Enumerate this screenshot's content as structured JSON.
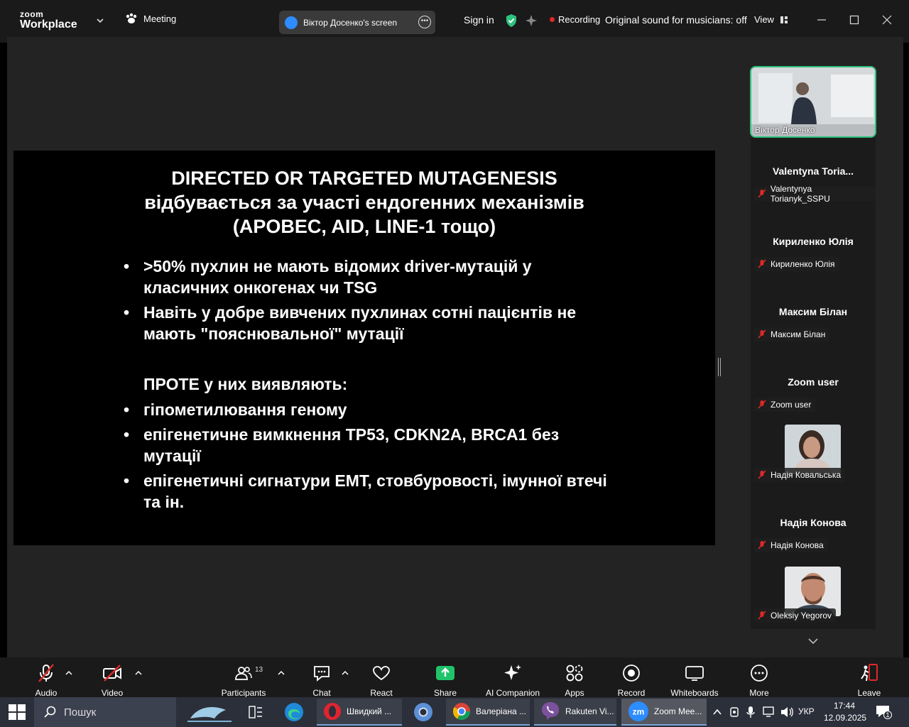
{
  "app": {
    "logo_top": "zoom",
    "logo_bottom": "Workplace",
    "meeting_label": "Meeting",
    "screen_share_label": "Віктор Досенко's screen",
    "sign_in": "Sign in",
    "recording": "Recording",
    "original_sound": "Original sound for musicians: off",
    "view": "View"
  },
  "slide": {
    "title_lines": [
      "DIRECTED OR TARGETED MUTAGENESIS",
      "відбувається за участі ендогенних механізмів",
      "(APOBEC, AID, LINE-1 тощо)"
    ],
    "bullets_a": [
      ">50% пухлин не мають відомих driver-мутацій у класичних онкогенах чи TSG",
      "Навіть у добре вивчених пухлинах сотні пацієнтів не мають \"пояснювальної\" мутації"
    ],
    "however": "ПРОТЕ у них виявляють:",
    "bullets_b": [
      "гіпометилювання геному",
      "епігенетичне вимкнення TP53, CDKN2A, BRCA1 без мутації",
      "епігенетичні сигнатури EMT, стовбуровості, імунної втечі та ін."
    ],
    "bullet_symbol": "•"
  },
  "participants": {
    "self": "Віктор Досенко",
    "tiles": [
      {
        "title": "Valentyna  Toria...",
        "label": "Valentynya Torianyk_SSPU"
      },
      {
        "title": "Кириленко Юлія",
        "label": "Кириленко Юлія"
      },
      {
        "title": "Максим Білан",
        "label": "Максим Білан"
      },
      {
        "title": "Zoom user",
        "label": "Zoom user"
      },
      {
        "title": "",
        "label": "Надія Ковальська"
      },
      {
        "title": "Надія Конова",
        "label": "Надія Конова"
      },
      {
        "title": "",
        "label": "Oleksiy Yegorov"
      }
    ]
  },
  "toolbar": {
    "audio": "Audio",
    "video": "Video",
    "participants": "Participants",
    "participants_count": "13",
    "chat": "Chat",
    "react": "React",
    "share": "Share",
    "ai_companion": "AI Companion",
    "apps": "Apps",
    "record": "Record",
    "whiteboards": "Whiteboards",
    "more": "More",
    "leave": "Leave"
  },
  "taskbar": {
    "search_placeholder": "Пошук",
    "apps": [
      {
        "label": "Швидкий ..."
      },
      {
        "label": "Валеріана ..."
      },
      {
        "label": "Rakuten Vi..."
      },
      {
        "label": "Zoom Mee..."
      }
    ],
    "language": "УКР",
    "time": "17:44",
    "date": "12.09.2025",
    "notification_count": "1"
  },
  "colors": {
    "accent_green": "#2ec27e",
    "share_green": "#1fc46a",
    "recording_red": "#e02828",
    "muted_red": "#e02828",
    "zoom_blue": "#2d8cff"
  }
}
